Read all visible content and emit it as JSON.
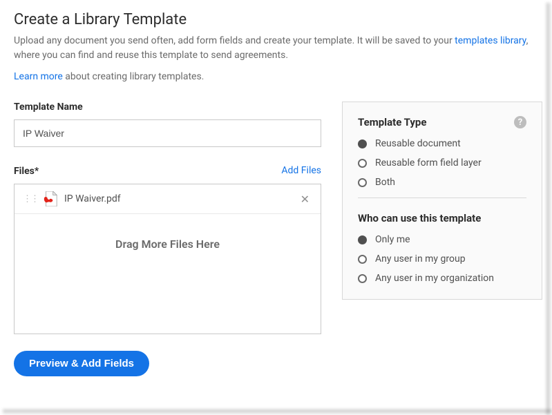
{
  "header": {
    "title": "Create a Library Template",
    "description_pre": "Upload any document you send often, add form fields and create your template. It will be saved to your ",
    "templates_link": "templates library",
    "description_post": ", where you can find and reuse this template to send agreements.",
    "learn_more": "Learn more",
    "learn_more_suffix": " about creating library templates."
  },
  "form": {
    "template_name_label": "Template Name",
    "template_name_value": "IP Waiver",
    "files_label": "Files",
    "asterisk": "*",
    "add_files": "Add Files",
    "uploaded_file_name": "IP Waiver.pdf",
    "drag_zone_text": "Drag More Files Here"
  },
  "panel": {
    "template_type_title": "Template Type",
    "help_glyph": "?",
    "type_options": {
      "reusable_document": "Reusable document",
      "form_field_layer": "Reusable form field layer",
      "both": "Both"
    },
    "permission_title": "Who can use this template",
    "permission_options": {
      "only_me": "Only me",
      "group": "Any user in my group",
      "org": "Any user in my organization"
    }
  },
  "actions": {
    "preview_button": "Preview & Add Fields"
  }
}
